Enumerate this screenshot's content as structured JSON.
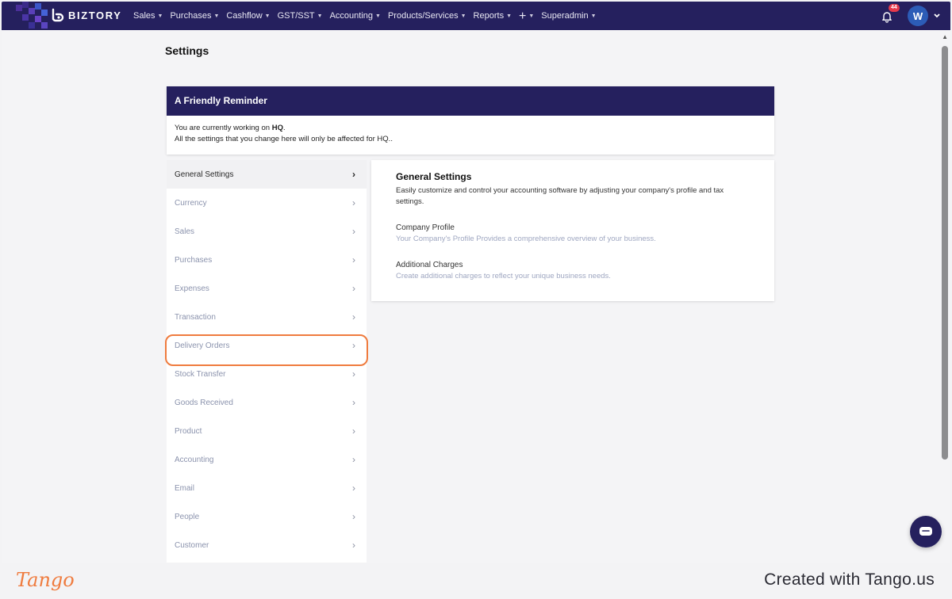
{
  "app": {
    "brand": "BIZTORY",
    "colors": {
      "nav_bg": "#25205e",
      "highlight": "#ef7b3e",
      "badge": "#e5394b",
      "avatar": "#2c5cb7"
    }
  },
  "nav": {
    "menu": [
      {
        "label": "Sales",
        "id": "sales"
      },
      {
        "label": "Purchases",
        "id": "purchases"
      },
      {
        "label": "Cashflow",
        "id": "cashflow"
      },
      {
        "label": "GST/SST",
        "id": "gst-sst"
      },
      {
        "label": "Accounting",
        "id": "accounting"
      },
      {
        "label": "Products/Services",
        "id": "products-services"
      },
      {
        "label": "Reports",
        "id": "reports"
      }
    ],
    "plus_label": "+",
    "superadmin_label": "Superadmin",
    "notification_count": "44",
    "avatar_initial": "W"
  },
  "page": {
    "title": "Settings"
  },
  "reminder": {
    "heading": "A Friendly Reminder",
    "line1_prefix": "You are currently working on ",
    "line1_branch": "HQ",
    "line1_suffix": ".",
    "line2": "All the settings that you change here will only be affected for HQ.."
  },
  "sidebar": {
    "items": [
      {
        "label": "General Settings",
        "active": true
      },
      {
        "label": "Currency"
      },
      {
        "label": "Sales"
      },
      {
        "label": "Purchases"
      },
      {
        "label": "Expenses"
      },
      {
        "label": "Transaction"
      },
      {
        "label": "Delivery Orders",
        "highlighted": true
      },
      {
        "label": "Stock Transfer"
      },
      {
        "label": "Goods Received"
      },
      {
        "label": "Product"
      },
      {
        "label": "Accounting"
      },
      {
        "label": "Email"
      },
      {
        "label": "People"
      },
      {
        "label": "Customer"
      }
    ]
  },
  "content": {
    "title": "General Settings",
    "description": "Easily customize and control your accounting software by adjusting your company's profile and tax settings.",
    "links": [
      {
        "title": "Company Profile",
        "desc": "Your Company's Profile Provides a comprehensive overview of your business."
      },
      {
        "title": "Additional Charges",
        "desc": "Create additional charges to reflect your unique business needs."
      }
    ]
  },
  "footer": {
    "logo_text": "Tango",
    "created_text": "Created with Tango.us"
  }
}
